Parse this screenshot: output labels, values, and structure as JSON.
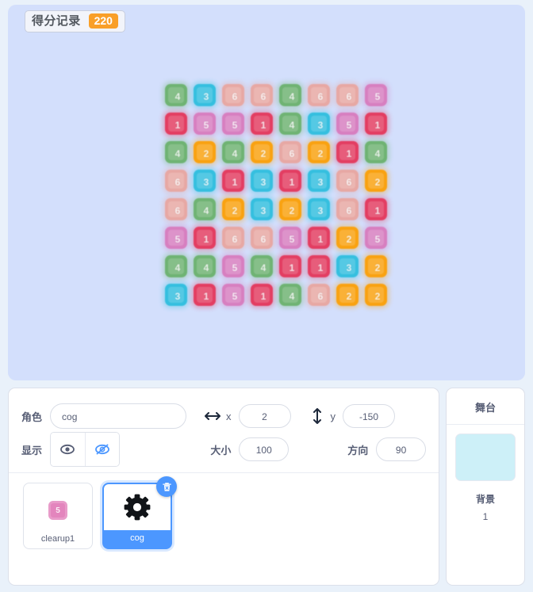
{
  "stage": {
    "readout": {
      "label": "得分记录",
      "value": "220"
    },
    "background_color": "#d3dffc"
  },
  "grid": {
    "rows": 8,
    "cols": 8,
    "values": [
      [
        4,
        3,
        6,
        6,
        4,
        6,
        6,
        5
      ],
      [
        1,
        5,
        5,
        1,
        4,
        3,
        5,
        1
      ],
      [
        4,
        2,
        4,
        2,
        6,
        2,
        1,
        4
      ],
      [
        6,
        3,
        1,
        3,
        1,
        3,
        6,
        2
      ],
      [
        6,
        4,
        2,
        3,
        2,
        3,
        6,
        1
      ],
      [
        5,
        1,
        6,
        6,
        5,
        1,
        2,
        5
      ],
      [
        4,
        4,
        5,
        4,
        1,
        1,
        3,
        2
      ],
      [
        3,
        1,
        5,
        1,
        4,
        6,
        2,
        2
      ]
    ],
    "color_map": {
      "1": "#e8446b",
      "2": "#f9a413",
      "3": "#3ec1e0",
      "4": "#73b473",
      "5": "#d островами",
      "6": "#e8a9a4"
    },
    "colors": {
      "1": "#e33e62",
      "2": "#f9a211",
      "3": "#35bfdf",
      "4": "#6fb373",
      "5": "#d77fc0",
      "6": "#e7a8a4"
    }
  },
  "sprite_info": {
    "name_label": "角色",
    "name_value": "cog",
    "x_label": "x",
    "x_value": "2",
    "y_label": "y",
    "y_value": "-150",
    "show_label": "显示",
    "size_label": "大小",
    "size_value": "100",
    "direction_label": "方向",
    "direction_value": "90",
    "visible": false,
    "accent_color": "#4c97ff"
  },
  "sprites": [
    {
      "name": "clearup1",
      "selected": false,
      "thumb_type": "tile",
      "thumb_number": "5",
      "thumb_color": "#e385bd"
    },
    {
      "name": "cog",
      "selected": true,
      "thumb_type": "gear"
    }
  ],
  "stage_panel": {
    "title": "舞台",
    "backdrop_label": "背景",
    "backdrop_count": "1",
    "thumb_color": "#cdf0f8"
  }
}
